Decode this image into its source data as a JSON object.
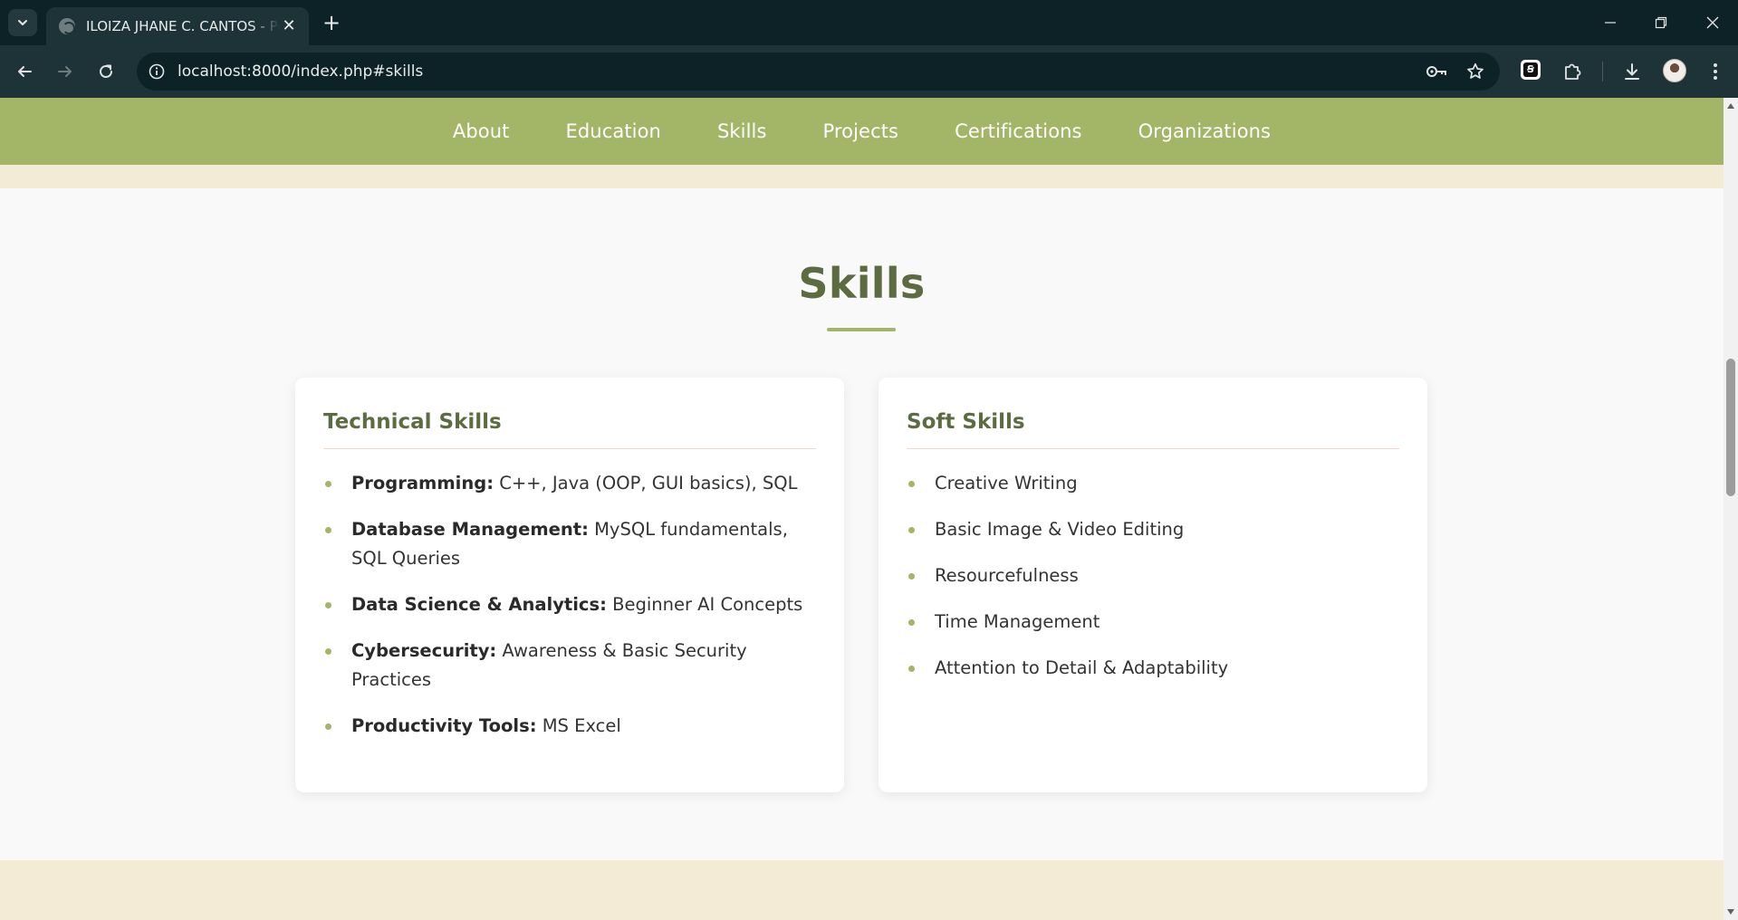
{
  "browser": {
    "tab_title": "ILOIZA JHANE C. CANTOS - Portfolio",
    "tab_close": "✕",
    "new_tab": "+",
    "url": "localhost:8000/index.php#skills"
  },
  "nav": {
    "items": [
      "About",
      "Education",
      "Skills",
      "Projects",
      "Certifications",
      "Organizations"
    ]
  },
  "section": {
    "title": "Skills"
  },
  "technical": {
    "heading": "Technical Skills",
    "items": [
      {
        "name": "Programming:",
        "detail": " C++, Java (OOP, GUI basics), SQL"
      },
      {
        "name": "Database Management:",
        "detail": " MySQL fundamentals, SQL Queries"
      },
      {
        "name": "Data Science & Analytics:",
        "detail": " Beginner AI Concepts"
      },
      {
        "name": "Cybersecurity:",
        "detail": " Awareness & Basic Security Practices"
      },
      {
        "name": "Productivity Tools:",
        "detail": " MS Excel"
      }
    ]
  },
  "soft": {
    "heading": "Soft Skills",
    "items": [
      "Creative Writing",
      "Basic Image & Video Editing",
      "Resourcefulness",
      "Time Management",
      "Attention to Detail & Adaptability"
    ]
  },
  "colors": {
    "accent_green": "#a3b566",
    "title_green": "#5c6b40",
    "cream": "#f4ebd6",
    "chrome_dark": "#0d2226",
    "chrome_toolbar": "#1e3337"
  },
  "icons": {
    "tab_search": "chevron-down-icon",
    "back": "arrow-left-icon",
    "forward": "arrow-right-icon",
    "reload": "reload-icon",
    "site_info": "info-icon",
    "password": "key-icon",
    "bookmark": "star-icon",
    "extension": "extension-logo-icon",
    "extensions": "puzzle-icon",
    "downloads": "download-icon",
    "profile": "avatar",
    "menu": "kebab-menu-icon"
  }
}
